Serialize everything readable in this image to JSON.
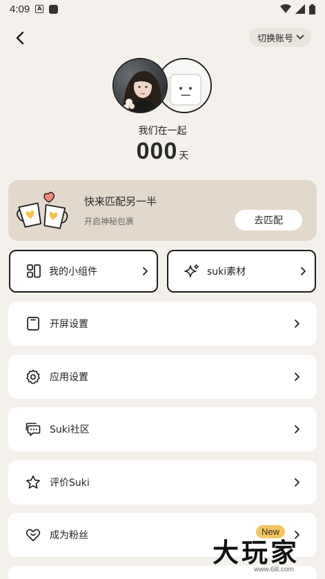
{
  "status_bar": {
    "time": "4:09"
  },
  "header": {
    "switch_account_label": "切换账号"
  },
  "couple": {
    "together_label": "我们在一起",
    "days_value": "000",
    "days_unit": "天"
  },
  "match": {
    "title": "快来匹配另一半",
    "subtitle": "开启神秘包裹",
    "button_label": "去匹配"
  },
  "tiles": [
    {
      "label": "我的小组件"
    },
    {
      "label": "suki素材"
    }
  ],
  "menu": [
    {
      "label": "开屏设置"
    },
    {
      "label": "应用设置"
    },
    {
      "label": "Suki社区"
    },
    {
      "label": "评价Suki"
    },
    {
      "label": "成为粉丝",
      "badge": "New"
    }
  ],
  "watermark": {
    "text": "大玩家",
    "sub": "www.6ill.com"
  },
  "colors": {
    "background": "#f4f1ec",
    "match_card": "#e2d8cb",
    "badge": "#f2c564"
  }
}
